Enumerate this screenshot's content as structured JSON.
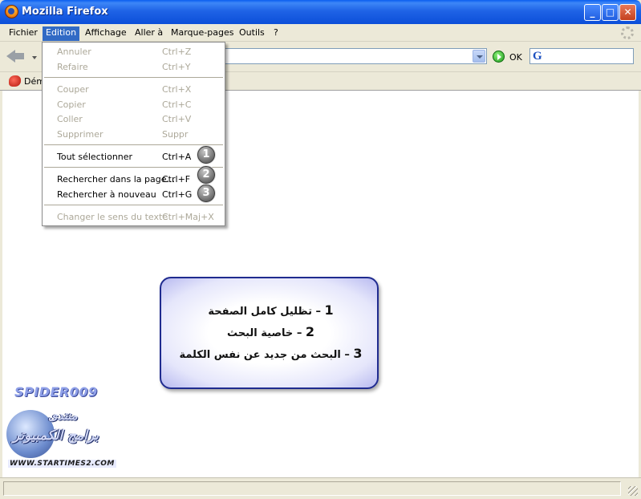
{
  "window": {
    "title": "Mozilla Firefox",
    "buttons": {
      "minimize": "_",
      "maximize": "□",
      "close": "✕"
    }
  },
  "menubar": {
    "items": [
      {
        "label": "Fichier"
      },
      {
        "label": "Edition",
        "active": true
      },
      {
        "label": "Affichage"
      },
      {
        "label": "Aller à"
      },
      {
        "label": "Marque-pages"
      },
      {
        "label": "Outils"
      },
      {
        "label": "?"
      }
    ]
  },
  "navbar": {
    "url": "",
    "go_label": "OK",
    "search_engine_letter": "G"
  },
  "bookmarks": {
    "first_label": "Dém"
  },
  "edit_menu": {
    "items": [
      {
        "label": "Annuler",
        "shortcut": "Ctrl+Z",
        "disabled": true
      },
      {
        "label": "Refaire",
        "shortcut": "Ctrl+Y",
        "disabled": true
      },
      {
        "label": "Couper",
        "shortcut": "Ctrl+X",
        "disabled": true
      },
      {
        "label": "Copier",
        "shortcut": "Ctrl+C",
        "disabled": true
      },
      {
        "label": "Coller",
        "shortcut": "Ctrl+V",
        "disabled": true
      },
      {
        "label": "Supprimer",
        "shortcut": "Suppr",
        "disabled": true
      },
      {
        "label": "Tout sélectionner",
        "shortcut": "Ctrl+A",
        "disabled": false,
        "badge": "1"
      },
      {
        "label": "Rechercher dans la page...",
        "shortcut": "Ctrl+F",
        "disabled": false,
        "badge": "2"
      },
      {
        "label": "Rechercher à nouveau",
        "shortcut": "Ctrl+G",
        "disabled": false,
        "badge": "3"
      },
      {
        "label": "Changer le sens du texte",
        "shortcut": "Ctrl+Maj+X",
        "disabled": true
      }
    ]
  },
  "annotation": {
    "lines": [
      {
        "num": "1",
        "text": "– تظليل كامل الصفحة"
      },
      {
        "num": "2",
        "text": "– خاصية البحث"
      },
      {
        "num": "3",
        "text": "– البحث من جديد عن نفس الكلمة"
      }
    ]
  },
  "watermark": {
    "title": "SPIDER009",
    "logo_line1": "منتدى",
    "logo_line2": "برامج الكمبيوتر",
    "site": "WWW.STARTIMES2.COM"
  },
  "colors": {
    "titlebar": "#0c4fd9",
    "menu_highlight": "#316ac5",
    "annotation_border": "#1f2b8f"
  }
}
